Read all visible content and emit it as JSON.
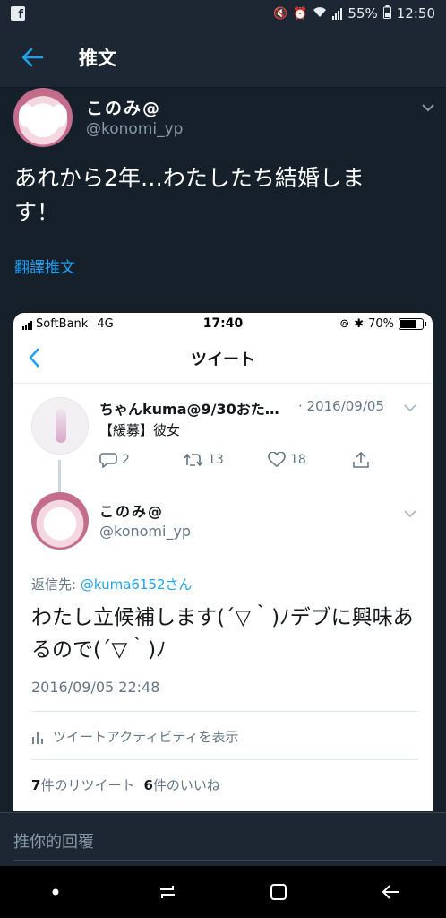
{
  "status_bar": {
    "battery": "55%",
    "time": "12:50",
    "app_icon": "facebook-icon"
  },
  "header": {
    "title": "推文",
    "back_icon": "back-arrow-icon"
  },
  "tweet": {
    "author_name": "このみ@",
    "author_handle": "@konomi_yp",
    "text": "あれから2年…わたしたち結婚します！",
    "translate_label": "翻譯推文"
  },
  "embedded": {
    "status": {
      "carrier": "SoftBank",
      "network": "4G",
      "time": "17:40",
      "battery": "70%"
    },
    "nav_title": "ツイート",
    "parent_tweet": {
      "name": "ちゃんkuma@9/30おた…",
      "date": "· 2016/09/05",
      "text": "【緩募】彼女",
      "reply_count": "2",
      "retweet_count": "13",
      "like_count": "18"
    },
    "main_tweet": {
      "name": "このみ@",
      "handle": "@konomi_yp",
      "reply_to_label": "返信先:",
      "reply_to_user": "@kuma6152さん",
      "text": "わたし立候補します(´▽｀)ﾉデブに興味あるので(´▽｀)ﾉ",
      "timestamp": "2016/09/05 22:48",
      "activity_label": "ツイートアクティビティを表示",
      "retweets_num": "7",
      "retweets_label": "件のリツイート",
      "likes_num": "6",
      "likes_label": "件のいいね"
    }
  },
  "reply_bar": {
    "placeholder": "推你的回覆"
  },
  "colors": {
    "background": "#15202b",
    "header": "#1c2733",
    "accent": "#1da1f2",
    "secondary_text": "#8899a6"
  }
}
